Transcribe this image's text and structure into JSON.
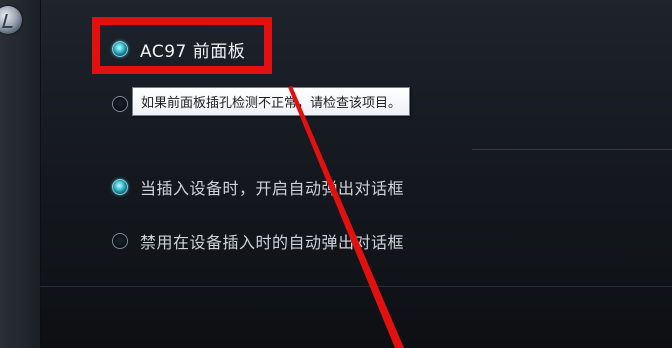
{
  "front_panel": {
    "ac97_label": "AC97 前面板",
    "tooltip": "如果前面板插孔检测不正常，请检查该项目。"
  },
  "auto_popup": {
    "option_enable": "当插入设备时，开启自动弹出对话框",
    "option_disable": "禁用在设备插入时的自动弹出对话框"
  },
  "state": {
    "ac97_selected": true,
    "hd_selected": false,
    "enable_popup_selected": true,
    "disable_popup_selected": false
  },
  "colors": {
    "annotation": "#e31010",
    "radio_selected": "#4fd0df",
    "label_text": "#cfd3d8"
  },
  "icons": {
    "app": "audio-manager-icon"
  }
}
